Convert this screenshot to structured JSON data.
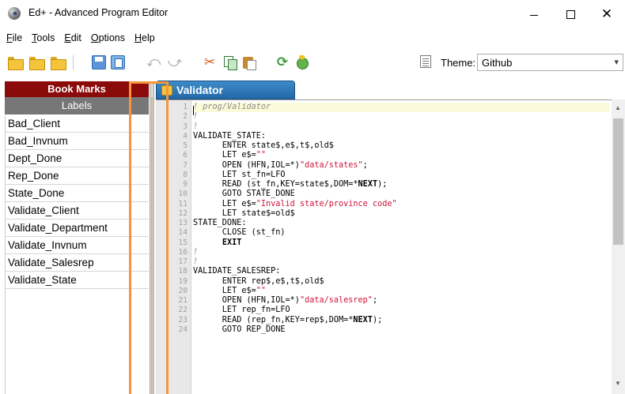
{
  "window": {
    "title": "Ed+ - Advanced Program Editor",
    "icon": "app-globe-icon"
  },
  "menu": [
    "File",
    "Tools",
    "Edit",
    "Options",
    "Help"
  ],
  "menu_underlines": [
    "F",
    "T",
    "E",
    "O",
    "H"
  ],
  "toolbar": {
    "icons": [
      "open-folder-icon",
      "open-recent-icon",
      "open-project-icon",
      "save-icon",
      "save-as-icon",
      "undo-icon",
      "redo-icon",
      "cut-icon",
      "copy-icon",
      "paste-icon",
      "refresh-icon",
      "debug-icon"
    ],
    "theme_label": "Theme:",
    "theme_value": "Github"
  },
  "bookmarks": {
    "header": "Book Marks",
    "subheader": "Labels",
    "items": [
      "Bad_Client",
      "Bad_Invnum",
      "Dept_Done",
      "Rep_Done",
      "State_Done",
      "Validate_Client",
      "Validate_Department",
      "Validate_Invnum",
      "Validate_Salesrep",
      "Validate_State"
    ]
  },
  "editor": {
    "tab_label": "Validator",
    "lines": [
      {
        "no": "1",
        "text": "! prog/Validator"
      },
      {
        "no": "2",
        "text": "!"
      },
      {
        "no": "3",
        "text": "!"
      },
      {
        "no": "4",
        "text": "VALIDATE_STATE:"
      },
      {
        "no": "5",
        "text": "      ENTER state$,e$,t$,old$"
      },
      {
        "no": "6",
        "text": "      LET e$=\"\""
      },
      {
        "no": "7",
        "text": "      OPEN (HFN,IOL=*)\"data/states\";"
      },
      {
        "no": "8",
        "text": "      LET st_fn=LFO"
      },
      {
        "no": "9",
        "text": "      READ (st_fn,KEY=state$,DOM=*NEXT);"
      },
      {
        "no": "10",
        "text": "      GOTO STATE_DONE"
      },
      {
        "no": "11",
        "text": "      LET e$=\"Invalid state/province code\""
      },
      {
        "no": "12",
        "text": "      LET state$=old$"
      },
      {
        "no": "13",
        "text": "STATE_DONE:"
      },
      {
        "no": "14",
        "text": "      CLOSE (st_fn)"
      },
      {
        "no": "15",
        "text": "      EXIT"
      },
      {
        "no": "16",
        "text": "!"
      },
      {
        "no": "17",
        "text": "!"
      },
      {
        "no": "18",
        "text": "VALIDATE_SALESREP:"
      },
      {
        "no": "19",
        "text": "      ENTER rep$,e$,t$,old$"
      },
      {
        "no": "20",
        "text": "      LET e$=\"\""
      },
      {
        "no": "21",
        "text": "      OPEN (HFN,IOL=*)\"data/salesrep\";"
      },
      {
        "no": "22",
        "text": "      LET rep_fn=LFO"
      },
      {
        "no": "23",
        "text": "      READ (rep_fn,KEY=rep$,DOM=*NEXT);"
      },
      {
        "no": "24",
        "text": "      GOTO REP_DONE"
      }
    ]
  },
  "colors": {
    "bookmark_header": "#8b0a0a",
    "tab": "#2a70b5",
    "string": "#d1123b",
    "comment": "#8b8b8b",
    "highlight": "#f4963a"
  }
}
